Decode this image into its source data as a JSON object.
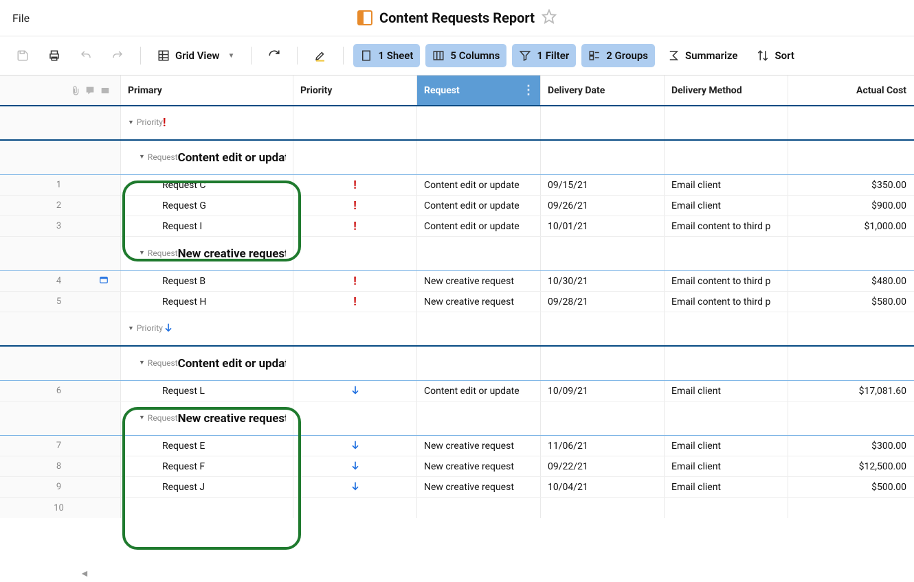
{
  "menubar": {
    "file": "File"
  },
  "title": "Content Requests Report",
  "toolbar": {
    "gridview": "Grid View",
    "sheet": "1 Sheet",
    "columns": "5 Columns",
    "filter": "1 Filter",
    "groups": "2 Groups",
    "summarize": "Summarize",
    "sort": "Sort"
  },
  "columns": {
    "primary": "Primary",
    "priority": "Priority",
    "request": "Request",
    "delivery_date": "Delivery Date",
    "delivery_method": "Delivery Method",
    "actual_cost": "Actual Cost"
  },
  "group_labels": {
    "priority": "Priority",
    "request": "Request"
  },
  "groups": {
    "g1": {
      "priority_icon": "high",
      "r1_label": "Content edit or updat",
      "r2_label": "New creative request"
    },
    "g2": {
      "priority_icon": "low",
      "r1_label": "Content edit or updat",
      "r2_label": "New creative request"
    }
  },
  "rows": {
    "1": {
      "n": "1",
      "primary": "Request C",
      "prio": "high",
      "request": "Content edit or update",
      "date": "09/15/21",
      "method": "Email client",
      "cost": "$350.00"
    },
    "2": {
      "n": "2",
      "primary": "Request G",
      "prio": "high",
      "request": "Content edit or update",
      "date": "09/26/21",
      "method": "Email client",
      "cost": "$900.00"
    },
    "3": {
      "n": "3",
      "primary": "Request I",
      "prio": "high",
      "request": "Content edit or update",
      "date": "10/01/21",
      "method": "Email content to third p",
      "cost": "$1,000.00"
    },
    "4": {
      "n": "4",
      "primary": "Request B",
      "prio": "high",
      "request": "New creative request",
      "date": "10/30/21",
      "method": "Email content to third p",
      "cost": "$480.00"
    },
    "5": {
      "n": "5",
      "primary": "Request H",
      "prio": "high",
      "request": "New creative request",
      "date": "09/28/21",
      "method": "Email content to third p",
      "cost": "$580.00"
    },
    "6": {
      "n": "6",
      "primary": "Request L",
      "prio": "low",
      "request": "Content edit or update",
      "date": "10/09/21",
      "method": "Email client",
      "cost": "$17,081.60"
    },
    "7": {
      "n": "7",
      "primary": "Request E",
      "prio": "low",
      "request": "New creative request",
      "date": "11/06/21",
      "method": "Email client",
      "cost": "$300.00"
    },
    "8": {
      "n": "8",
      "primary": "Request F",
      "prio": "low",
      "request": "New creative request",
      "date": "09/22/21",
      "method": "Email client",
      "cost": "$12,500.00"
    },
    "9": {
      "n": "9",
      "primary": "Request J",
      "prio": "low",
      "request": "New creative request",
      "date": "10/04/21",
      "method": "Email client",
      "cost": "$500.00"
    },
    "10": {
      "n": "10"
    }
  }
}
